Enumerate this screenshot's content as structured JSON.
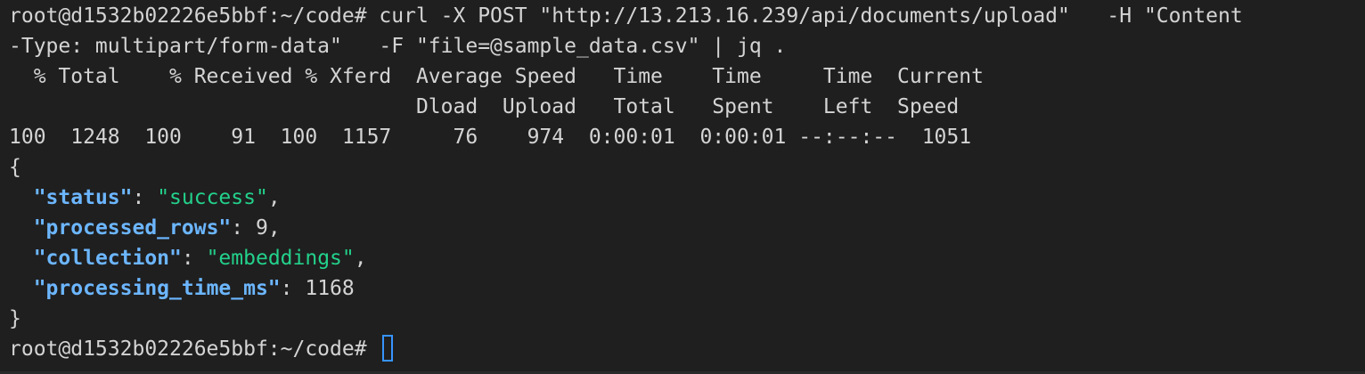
{
  "terminal": {
    "command_line_1": "root@d1532b02226e5bbf:~/code# curl -X POST \"http://13.213.16.239/api/documents/upload\"   -H \"Content",
    "command_line_2": "-Type: multipart/form-data\"   -F \"file=@sample_data.csv\" | jq .",
    "curl_header_1": "  % Total    % Received % Xferd  Average Speed   Time    Time     Time  Current",
    "curl_header_2": "                                 Dload  Upload   Total   Spent    Left  Speed",
    "curl_progress": "100  1248  100    91  100  1157     76    974  0:00:01  0:00:01 --:--:--  1051",
    "json_open": "{",
    "json_close": "}",
    "fields": [
      {
        "key": "\"status\"",
        "sep": ": ",
        "value": "\"success\"",
        "value_type": "string",
        "trail": ","
      },
      {
        "key": "\"processed_rows\"",
        "sep": ": ",
        "value": "9",
        "value_type": "number",
        "trail": ","
      },
      {
        "key": "\"collection\"",
        "sep": ": ",
        "value": "\"embeddings\"",
        "value_type": "string",
        "trail": ","
      },
      {
        "key": "\"processing_time_ms\"",
        "sep": ": ",
        "value": "1168",
        "value_type": "number",
        "trail": ""
      }
    ],
    "prompt": "root@d1532b02226e5bbf:~/code# "
  },
  "colors": {
    "background": "#1f1f1f",
    "foreground": "#d4d4d4",
    "json_key": "#6cb6ff",
    "json_string": "#23d18b",
    "cursor": "#3794ff"
  }
}
